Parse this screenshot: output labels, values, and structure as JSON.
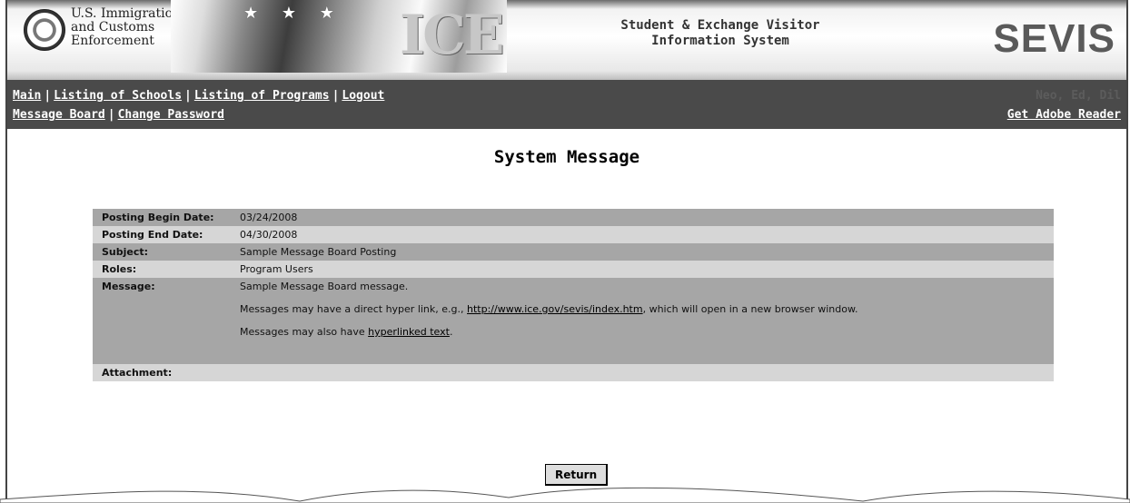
{
  "header": {
    "agency_line1": "U.S. Immigration",
    "agency_line2": "and Customs",
    "agency_line3": "Enforcement",
    "ice_logo": "ICE",
    "system_line1": "Student & Exchange Visitor",
    "system_line2": "Information System",
    "brand": "SEVIS"
  },
  "nav": {
    "row1": [
      "Main",
      "Listing of Schools",
      "Listing of Programs",
      "Logout"
    ],
    "row2": [
      "Message Board",
      "Change Password"
    ],
    "user": "Neo, Ed, Dil",
    "adobe": "Get Adobe Reader"
  },
  "page_title": "System Message",
  "detail": {
    "begin_label": "Posting Begin Date:",
    "begin_value": "03/24/2008",
    "end_label": "Posting End Date:",
    "end_value": "04/30/2008",
    "subject_label": "Subject:",
    "subject_value": "Sample Message Board Posting",
    "roles_label": "Roles:",
    "roles_value": "Program Users",
    "message_label": "Message:",
    "message_line1": "Sample Message Board message.",
    "message_line2_pre": "Messages may have a direct hyper link, e.g., ",
    "message_line2_link": "http://www.ice.gov/sevis/index.htm",
    "message_line2_post": ", which will open in a new browser window.",
    "message_line3_pre": "Messages may also have ",
    "message_line3_link": "hyperlinked text",
    "message_line3_post": ".",
    "attachment_label": "Attachment:",
    "attachment_value": ""
  },
  "return_button": "Return"
}
